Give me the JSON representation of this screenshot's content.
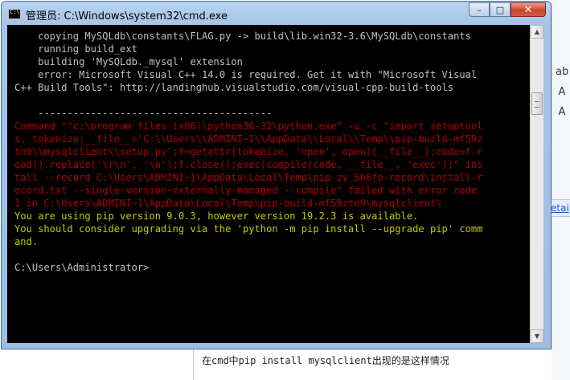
{
  "window": {
    "title": "管理员: C:\\Windows\\system32\\cmd.exe",
    "icon": "cmd-icon",
    "controls": {
      "minimize": "–",
      "maximize": "□",
      "close": "✕"
    }
  },
  "console": {
    "lines": [
      {
        "color": "gray",
        "text": "    copying MySQLdb\\constants\\FLAG.py -> build\\lib.win32-3.6\\MySQLdb\\constants"
      },
      {
        "color": "gray",
        "text": "    running build_ext"
      },
      {
        "color": "gray",
        "text": "    building 'MySQLdb._mysql' extension"
      },
      {
        "color": "gray",
        "text": "    error: Microsoft Visual C++ 14.0 is required. Get it with \"Microsoft Visual"
      },
      {
        "color": "gray",
        "text": "C++ Build Tools\": http://landinghub.visualstudio.com/visual-cpp-build-tools"
      },
      {
        "color": "gray",
        "text": ""
      },
      {
        "color": "gray",
        "text": "    ----------------------------------------"
      },
      {
        "color": "red",
        "text": "Command \"\"c:\\program files (x86)\\python36-32\\python.exe\" -u -c \"import setuptool"
      },
      {
        "color": "red",
        "text": "s, tokenize;__file__='C:\\\\Users\\\\ADMINI~1\\\\AppData\\\\Local\\\\Temp\\\\pip-build-mf59z"
      },
      {
        "color": "red",
        "text": "tn9\\\\mysqlclient\\\\setup.py';f=getattr(tokenize, 'open', open)(__file__);code=f.r"
      },
      {
        "color": "red",
        "text": "ead().replace('\\r\\n', '\\n');f.close();exec(compile(code, __file__, 'exec'))\" ins"
      },
      {
        "color": "red",
        "text": "tall --record C:\\Users\\ADMINI~1\\AppData\\Local\\Temp\\pip-zy_5h6fo-record\\install-r"
      },
      {
        "color": "red",
        "text": "ecord.txt --single-version-externally-managed --compile\" failed with error code"
      },
      {
        "color": "red",
        "text": "1 in C:\\Users\\ADMINI~1\\AppData\\Local\\Temp\\pip-build-mf59ztn9\\mysqlclient\\"
      },
      {
        "color": "yellow",
        "text": "You are using pip version 9.0.3, however version 19.2.3 is available."
      },
      {
        "color": "yellow",
        "text": "You should consider upgrading via the 'python -m pip install --upgrade pip' comm"
      },
      {
        "color": "yellow",
        "text": "and."
      },
      {
        "color": "gray",
        "text": ""
      },
      {
        "color": "gray",
        "text": "C:\\Users\\Administrator>"
      }
    ]
  },
  "scrollbar": {
    "up": "▲",
    "down": "▼"
  },
  "background": {
    "side_icons": [
      "ab",
      "A",
      "A"
    ],
    "link_fragment": "etai",
    "bottom_text": "在cmd中pip install mysqlclient出现的是这样情况"
  },
  "colors": {
    "console_bg": "#000000",
    "gray": "#c0c0c0",
    "red": "#b00000",
    "yellow": "#c7c700"
  }
}
